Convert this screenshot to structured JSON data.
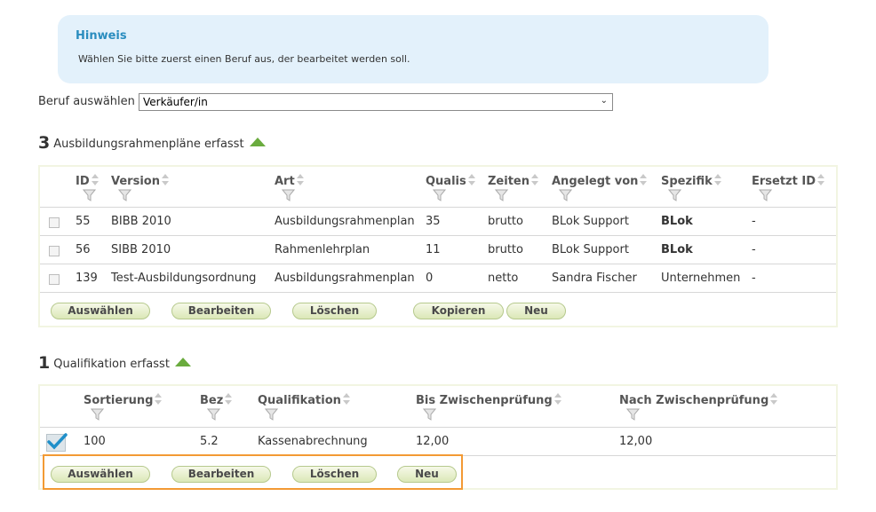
{
  "hint": {
    "title": "Hinweis",
    "text": "Wählen Sie bitte zuerst einen Beruf aus, der bearbeitet werden soll."
  },
  "beruf": {
    "label": "Beruf auswählen",
    "selected": "Verkäufer/in"
  },
  "plans": {
    "count": "3",
    "title": "Ausbildungsrahmenpläne erfasst",
    "columns": {
      "id": "ID",
      "version": "Version",
      "art": "Art",
      "qualis": "Qualis",
      "zeiten": "Zeiten",
      "angelegt": "Angelegt von",
      "spezifik": "Spezifik",
      "ersetzt": "Ersetzt ID"
    },
    "rows": [
      {
        "id": "55",
        "version": "BIBB 2010",
        "art": "Ausbildungsrahmenplan",
        "qualis": "35",
        "zeiten": "brutto",
        "angelegt": "BLok Support",
        "spezifik": "BLok",
        "ersetzt": "-"
      },
      {
        "id": "56",
        "version": "SIBB 2010",
        "art": "Rahmenlehrplan",
        "qualis": "11",
        "zeiten": "brutto",
        "angelegt": "BLok Support",
        "spezifik": "BLok",
        "ersetzt": "-"
      },
      {
        "id": "139",
        "version": "Test-Ausbildungsordnung",
        "art": "Ausbildungsrahmenplan",
        "qualis": "0",
        "zeiten": "netto",
        "angelegt": "Sandra Fischer",
        "spezifik": "Unternehmen",
        "ersetzt": "-"
      }
    ],
    "buttons": {
      "select": "Auswählen",
      "edit": "Bearbeiten",
      "delete": "Löschen",
      "copy": "Kopieren",
      "new": "Neu"
    }
  },
  "quals": {
    "count": "1",
    "title": "Qualifikation erfasst",
    "columns": {
      "sortierung": "Sortierung",
      "bez": "Bez",
      "qualifikation": "Qualifikation",
      "bis": "Bis Zwischenprüfung",
      "nach": "Nach Zwischenprüfung"
    },
    "rows": [
      {
        "sortierung": "100",
        "bez": "5.2",
        "qualifikation": "Kassenabrechnung",
        "bis": "12,00",
        "nach": "12,00",
        "checked": true
      }
    ],
    "buttons": {
      "select": "Auswählen",
      "edit": "Bearbeiten",
      "delete": "Löschen",
      "new": "Neu"
    }
  },
  "colors": {
    "hint_bg": "#e3f1fb",
    "hint_title": "#2a8dbf",
    "accent_green": "#6aab3e",
    "button_border": "#b6c98d",
    "highlight": "#f39a34",
    "check": "#1f8fc9"
  }
}
